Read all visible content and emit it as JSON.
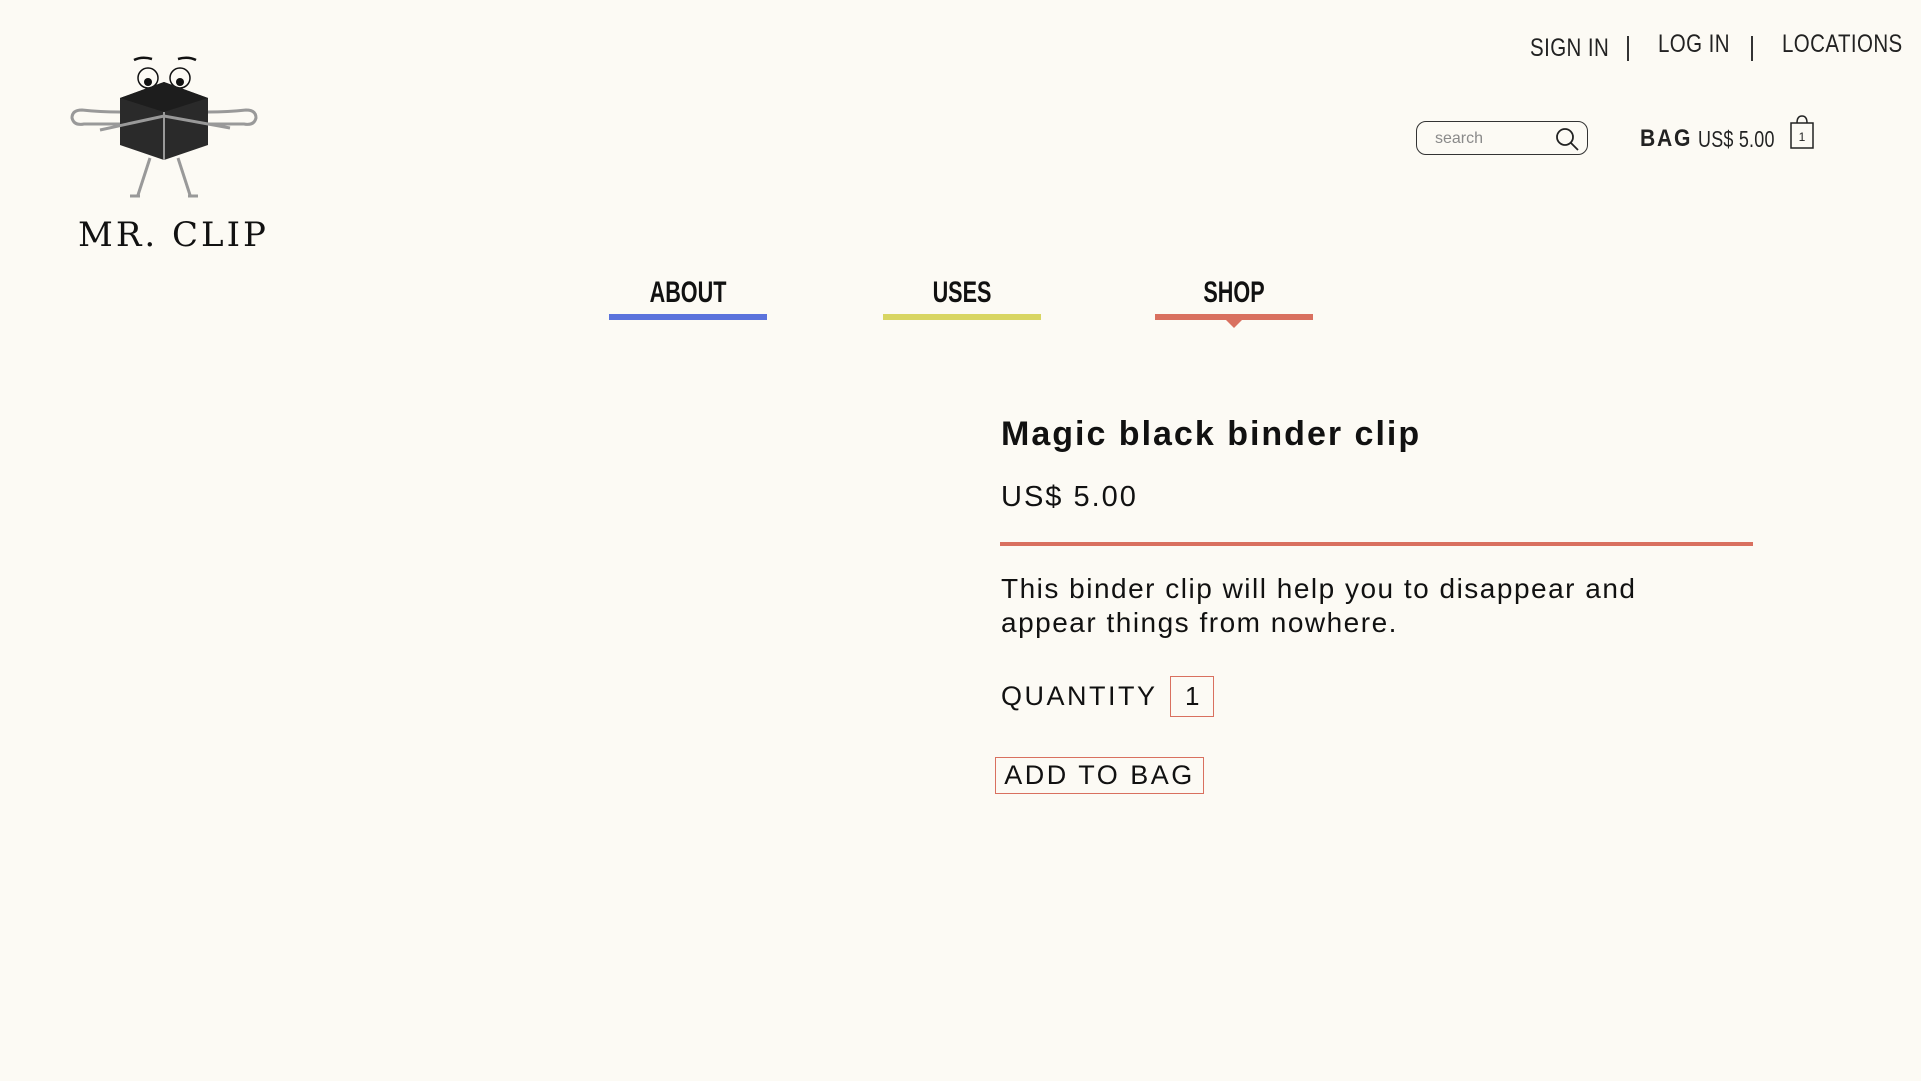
{
  "brand": {
    "name": "MR. CLIP",
    "logo_icon": "binder-clip-mascot-icon"
  },
  "top_links": {
    "sign_in": "SIGN IN",
    "log_in": "LOG IN",
    "locations": "LOCATIONS"
  },
  "search": {
    "placeholder": "search",
    "value": "",
    "icon": "search-icon"
  },
  "bag": {
    "label": "BAG",
    "total": "US$ 5.00",
    "count": "1",
    "icon": "shopping-bag-icon"
  },
  "nav": {
    "tabs": [
      {
        "label": "ABOUT",
        "color": "#5b73dc"
      },
      {
        "label": "USES",
        "color": "#d8d562"
      },
      {
        "label": "SHOP",
        "color": "#d9705f",
        "active": true
      }
    ]
  },
  "product": {
    "title": "Magic black binder clip",
    "price": "US$ 5.00",
    "description": "This binder clip will help you to disappear and appear things from nowhere.",
    "quantity_label": "QUANTITY",
    "quantity_value": "1",
    "add_to_bag_label": "ADD TO BAG",
    "accent_color": "#d9705f"
  },
  "colors": {
    "background": "#fcfaf4",
    "text": "#111111"
  }
}
